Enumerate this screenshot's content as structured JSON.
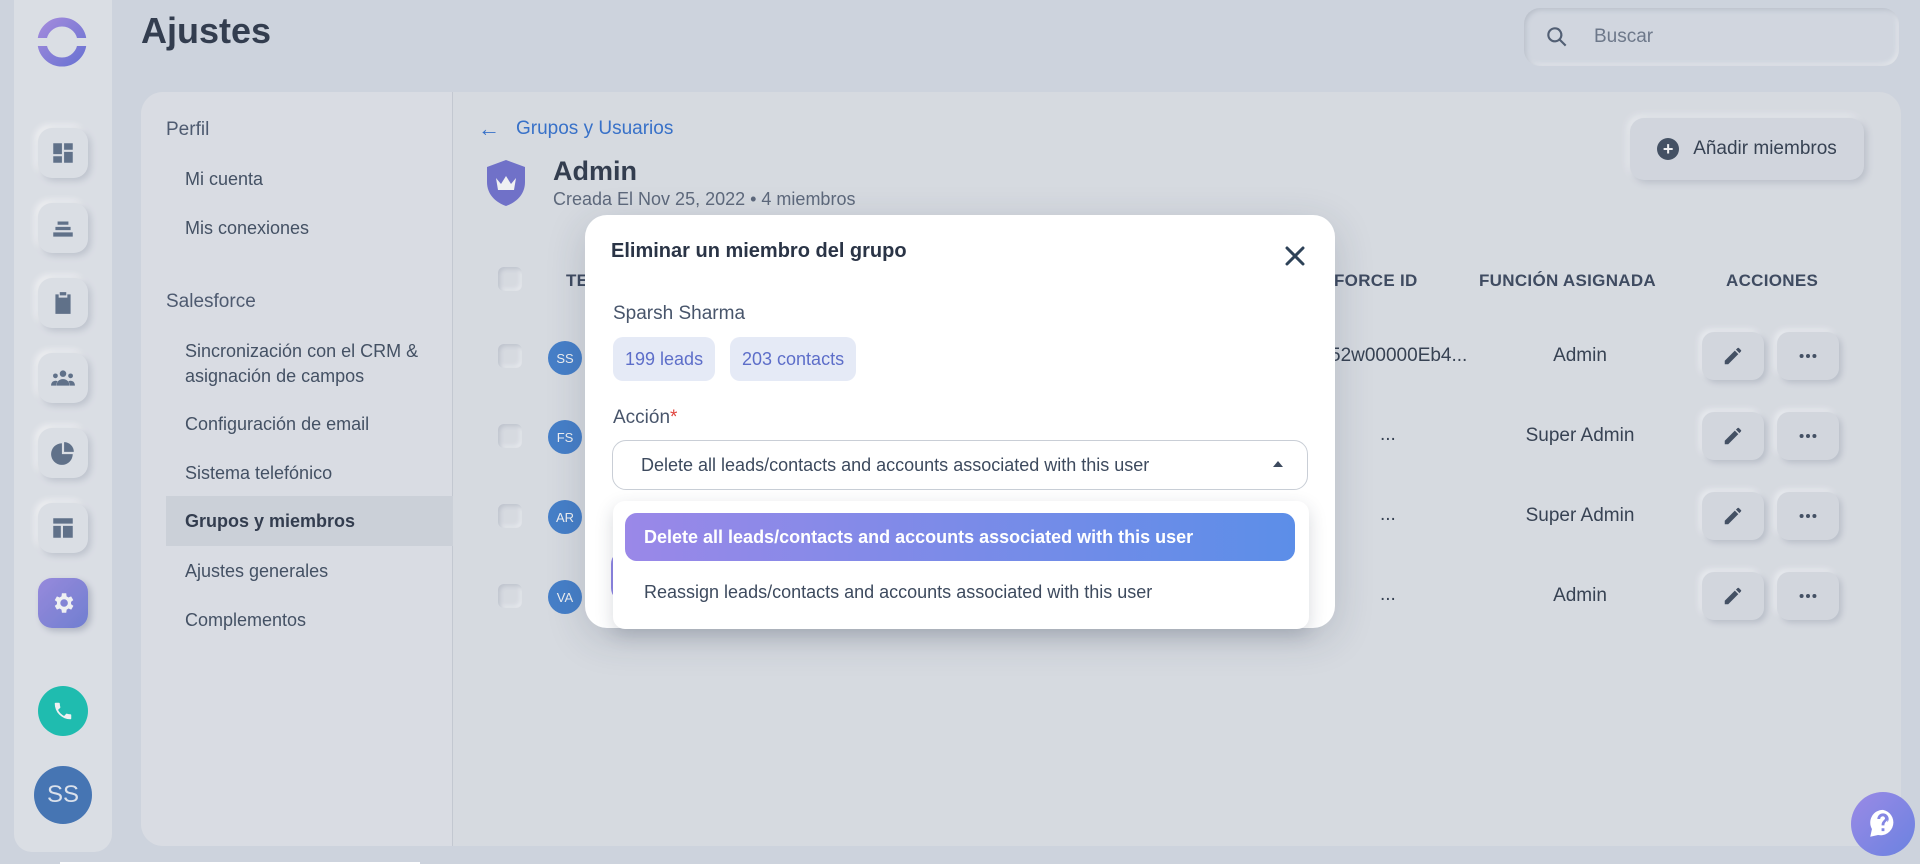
{
  "app": {
    "page_title": "Ajustes",
    "search_placeholder": "Buscar",
    "user_initials": "SS"
  },
  "settings_nav": {
    "sections": [
      {
        "title": "Perfil",
        "items": [
          "Mi cuenta",
          "Mis conexiones"
        ]
      },
      {
        "title": "Salesforce",
        "items": [
          "Sincronización con el CRM & asignación de campos",
          "Configuración de email",
          "Sistema telefónico",
          "Grupos y miembros",
          "Ajustes generales",
          "Complementos"
        ]
      }
    ],
    "active_item": "Grupos y miembros"
  },
  "group": {
    "back_label": "Grupos y Usuarios",
    "name": "Admin",
    "meta": "Creada El Nov 25, 2022 •  4 miembros",
    "add_members_label": "Añadir miembros"
  },
  "table": {
    "headers": {
      "name_partial": "TE",
      "sfid_partial": "FORCE ID",
      "role": "FUNCIÓN ASIGNADA",
      "actions": "ACCIONES"
    },
    "rows": [
      {
        "initials": "SS",
        "sfid": "52w00000Eb4...",
        "role": "Admin"
      },
      {
        "initials": "FS",
        "sfid": "...",
        "role": "Super Admin"
      },
      {
        "initials": "AR",
        "sfid": "...",
        "role": "Super Admin"
      },
      {
        "initials": "VA",
        "sfid": "...",
        "role": "Admin"
      }
    ]
  },
  "modal": {
    "title": "Eliminar un miembro del grupo",
    "member_name": "Sparsh Sharma",
    "chips": [
      "199 leads",
      "203 contacts"
    ],
    "action_label": "Acción",
    "required_mark": "*",
    "selected_value": "Delete all leads/contacts and accounts associated with this user",
    "options": [
      "Delete all leads/contacts and accounts associated with this user",
      "Reassign leads/contacts and accounts associated with this user"
    ]
  },
  "colors": {
    "accent": "#2f6fd0",
    "gradient_start": "#9a88e8",
    "gradient_end": "#5c8ee8",
    "call": "#13c4b3"
  }
}
